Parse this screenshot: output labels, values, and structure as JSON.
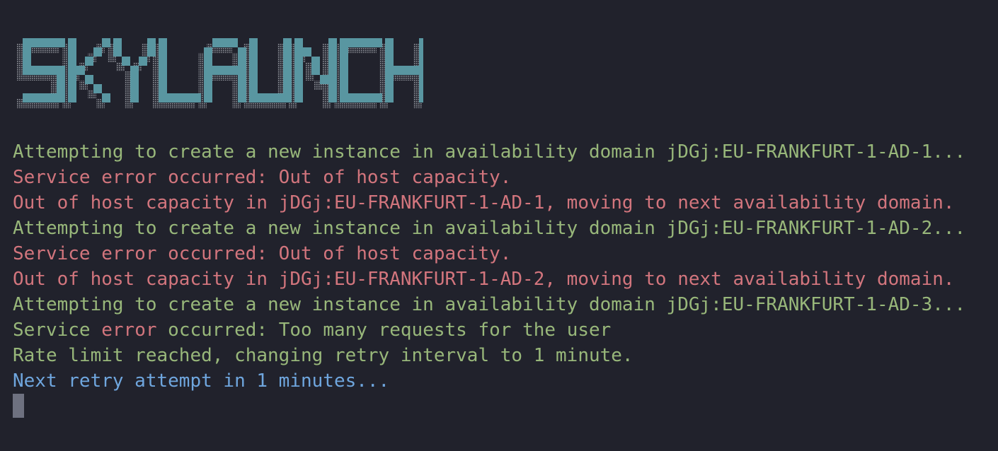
{
  "banner": {
    "text": "SKYLAUNCH",
    "color": "#5996a1",
    "shadow_color": "#8a8c94"
  },
  "colors": {
    "background": "#21222c",
    "info": "#98b77a",
    "error": "#d2757d",
    "notice": "#6fa6de",
    "cursor": "#6e7180"
  },
  "log": [
    {
      "segments": [
        {
          "text": "Attempting to create a new instance in availability domain jDGj:EU-FRANKFURT-1-AD-1...",
          "tone": "green"
        }
      ]
    },
    {
      "segments": [
        {
          "text": "Service error occurred: Out of host capacity.",
          "tone": "red"
        }
      ]
    },
    {
      "segments": [
        {
          "text": "Out of host capacity in jDGj:EU-FRANKFURT-1-AD-1, moving to next availability domain.",
          "tone": "red"
        }
      ]
    },
    {
      "segments": [
        {
          "text": "Attempting to create a new instance in availability domain jDGj:EU-FRANKFURT-1-AD-2...",
          "tone": "green"
        }
      ]
    },
    {
      "segments": [
        {
          "text": "Service error occurred: Out of host capacity.",
          "tone": "red"
        }
      ]
    },
    {
      "segments": [
        {
          "text": "Out of host capacity in jDGj:EU-FRANKFURT-1-AD-2, moving to next availability domain.",
          "tone": "red"
        }
      ]
    },
    {
      "segments": [
        {
          "text": "Attempting to create a new instance in availability domain jDGj:EU-FRANKFURT-1-AD-3...",
          "tone": "green"
        }
      ]
    },
    {
      "segments": [
        {
          "text": "Service ",
          "tone": "green"
        },
        {
          "text": "error",
          "tone": "red"
        },
        {
          "text": " occurred: Too many requests for the user",
          "tone": "green"
        }
      ]
    },
    {
      "segments": [
        {
          "text": "Rate limit reached, changing retry interval to 1 minute.",
          "tone": "green"
        }
      ]
    },
    {
      "segments": [
        {
          "text": "Next retry attempt in 1 minutes...",
          "tone": "blue"
        }
      ]
    }
  ]
}
